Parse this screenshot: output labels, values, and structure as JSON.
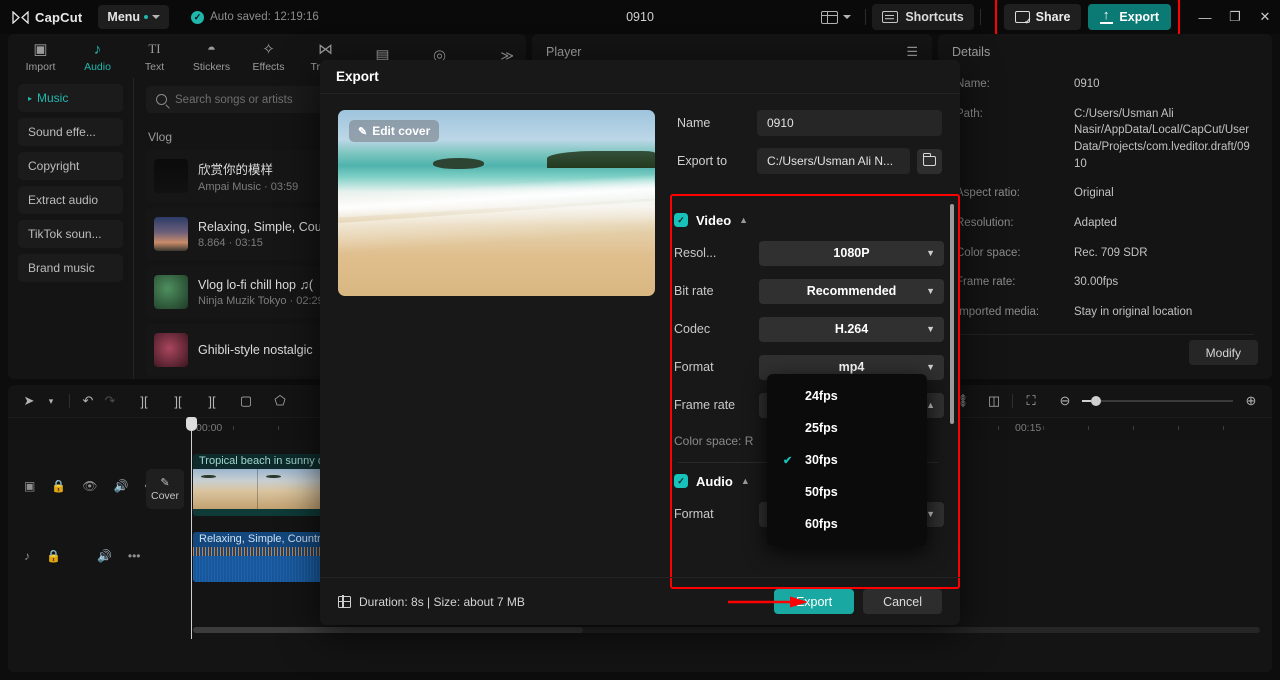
{
  "titlebar": {
    "brand": "CapCut",
    "menu_label": "Menu",
    "autosave": "Auto saved: 12:19:16",
    "project_title": "0910",
    "shortcuts_label": "Shortcuts",
    "share_label": "Share",
    "export_label": "Export",
    "minimize": "—",
    "maximize": "❐",
    "close": "✕",
    "accent": "#1fb6ac",
    "export_btn_color": "#0c7a74",
    "annotation_color": "#ff0000"
  },
  "nav_tabs": [
    {
      "label": "Import",
      "icon": "import-icon",
      "glyph": "▣",
      "active": false
    },
    {
      "label": "Audio",
      "icon": "audio-note-icon",
      "glyph": "♪",
      "active": true
    },
    {
      "label": "Text",
      "icon": "text-icon",
      "glyph": "TI",
      "active": false
    },
    {
      "label": "Stickers",
      "icon": "sticker-icon",
      "glyph": "◓",
      "active": false
    },
    {
      "label": "Effects",
      "icon": "effects-star-icon",
      "glyph": "✧",
      "active": false
    },
    {
      "label": "Tran...",
      "icon": "transition-icon",
      "glyph": "⋈",
      "active": false
    },
    {
      "label": "",
      "icon": "captions-icon",
      "glyph": "▤",
      "active": false
    },
    {
      "label": "",
      "icon": "filters-icon",
      "glyph": "◎",
      "active": false
    }
  ],
  "audio_subnav": [
    {
      "label": "Music",
      "active": true,
      "caret": "▸"
    },
    {
      "label": "Sound effe...",
      "active": false
    },
    {
      "label": "Copyright",
      "active": false
    },
    {
      "label": "Extract audio",
      "active": false
    },
    {
      "label": "TikTok soun...",
      "active": false
    },
    {
      "label": "Brand music",
      "active": false
    }
  ],
  "search": {
    "placeholder": "Search songs or artists",
    "icon": "search-icon"
  },
  "music_section": {
    "title": "Vlog",
    "songs": [
      {
        "name": "欣赏你的模样",
        "sub": "Ampai Music · 03:59",
        "thumb": "t1"
      },
      {
        "name": "Relaxing, Simple, Cou",
        "sub": "8.864 · 03:15",
        "thumb": "t2"
      },
      {
        "name": "Vlog  lo-fi chill hop ♫(",
        "sub": "Ninja Muzik Tokyo · 02:29",
        "thumb": "t3"
      },
      {
        "name": "Ghibli-style nostalgic",
        "sub": "",
        "thumb": "t4"
      }
    ]
  },
  "player_panel": {
    "title": "Player",
    "menu_icon": "hamburger-icon"
  },
  "details_panel": {
    "title": "Details",
    "rows": [
      {
        "key": "Name:",
        "value": "0910"
      },
      {
        "key": "Path:",
        "value": "C:/Users/Usman Ali Nasir/AppData/Local/CapCut/User Data/Projects/com.lveditor.draft/0910"
      },
      {
        "key": "Aspect ratio:",
        "value": "Original"
      },
      {
        "key": "Resolution:",
        "value": "Adapted"
      },
      {
        "key": "Color space:",
        "value": "Rec. 709 SDR"
      },
      {
        "key": "Frame rate:",
        "value": "30.00fps"
      },
      {
        "key": "Imported media:",
        "value": "Stay in original location"
      }
    ],
    "modify_label": "Modify"
  },
  "timeline": {
    "left_tools": [
      "select-arrow-icon",
      "chevron-down-icon",
      "undo-icon",
      "redo-icon",
      "split-icon",
      "trim-left-icon",
      "trim-right-icon",
      "delete-icon",
      "mask-icon"
    ],
    "right_tools": [
      "keyframe-icon",
      "link-icon",
      "mirror-icon",
      "crop-icon",
      "zoom-out-icon",
      "zoom-in-icon"
    ],
    "ruler_labels": [
      "00:00",
      "00:15"
    ],
    "playhead_time": "00:00",
    "cover_chip": "Cover",
    "video_clip_label": "Tropical beach in sunny d",
    "audio_clip_label": "Relaxing, Simple, Country",
    "track_icons_video": [
      "video-track-icon",
      "lock-icon",
      "eye-icon",
      "speaker-icon",
      "more-icon"
    ],
    "track_icons_audio": [
      "audio-track-icon",
      "lock-icon",
      "speaker-icon",
      "more-icon"
    ]
  },
  "export_dialog": {
    "title": "Export",
    "edit_cover_label": "Edit cover",
    "edit_cover_icon": "pencil-icon",
    "name_label": "Name",
    "name_value": "0910",
    "export_to_label": "Export to",
    "export_to_value": "C:/Users/Usman Ali N...",
    "folder_icon": "folder-icon",
    "video_section": {
      "label": "Video",
      "checked": true,
      "rows": [
        {
          "label": "Resol...",
          "value": "1080P",
          "icon": "chevron-down-icon"
        },
        {
          "label": "Bit rate",
          "value": "Recommended",
          "icon": "chevron-down-icon"
        },
        {
          "label": "Codec",
          "value": "H.264",
          "icon": "chevron-down-icon"
        },
        {
          "label": "Format",
          "value": "mp4",
          "icon": "chevron-down-icon"
        },
        {
          "label": "Frame rate",
          "value": "30fps",
          "icon": "chevron-up-icon"
        }
      ],
      "note": "Color space: R"
    },
    "audio_section": {
      "label": "Audio",
      "checked": true,
      "rows": [
        {
          "label": "Format",
          "value": "",
          "icon": "chevron-down-icon"
        }
      ]
    },
    "framerate_dropdown": {
      "options": [
        {
          "label": "24fps",
          "selected": false
        },
        {
          "label": "25fps",
          "selected": false
        },
        {
          "label": "30fps",
          "selected": true
        },
        {
          "label": "50fps",
          "selected": false
        },
        {
          "label": "60fps",
          "selected": false
        }
      ]
    },
    "footer": {
      "duration_text": "Duration: 8s | Size: about 7 MB",
      "duration_icon": "film-icon",
      "export_label": "Export",
      "cancel_label": "Cancel",
      "export_color": "#1aa9a2"
    }
  }
}
